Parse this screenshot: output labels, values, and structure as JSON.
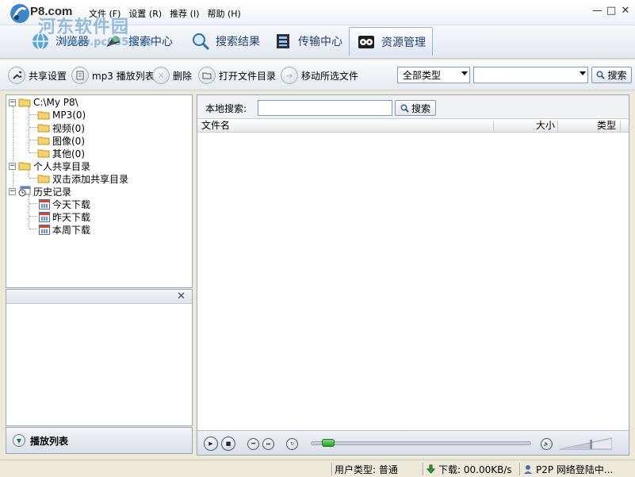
{
  "app": {
    "brand": "P8.com",
    "watermark_line1": "河东软件园",
    "watermark_line2": "www.pc0359.cn"
  },
  "menu": [
    "文件 (F)",
    "设置 (R)",
    "推荐 (I)",
    "帮助 (H)"
  ],
  "window_controls": {
    "minimize": "—",
    "maximize": "□",
    "close": "✕"
  },
  "tabs": [
    {
      "label": "浏览器",
      "icon": "browser-icon",
      "active": false
    },
    {
      "label": "搜索中心",
      "icon": "search-center-icon",
      "active": false
    },
    {
      "label": "搜索结果",
      "icon": "magnifier-icon",
      "active": false
    },
    {
      "label": "传输中心",
      "icon": "transfer-icon",
      "active": false
    },
    {
      "label": "资源管理",
      "icon": "film-reel-icon",
      "active": true
    }
  ],
  "toolbar": {
    "share_settings": "共享设置",
    "mp3_playlist": "mp3 播放列表",
    "delete": "删除",
    "open_folder": "打开文件目录",
    "move_selected": "移动所选文件",
    "type_filter": "全部类型",
    "search_value": "",
    "search_button": "搜索"
  },
  "tree": {
    "root": "C:\\My P8\\",
    "root_children": [
      "MP3(0)",
      "视频(0)",
      "图像(0)",
      "其他(0)"
    ],
    "shared": "个人共享目录",
    "shared_child": "双击添加共享目录",
    "history": "历史记录",
    "history_children": [
      "今天下载",
      "昨天下载",
      "本周下载"
    ]
  },
  "sub_panel": {
    "close": "✕"
  },
  "playlist": {
    "label": "播放列表"
  },
  "local_search": {
    "label": "本地搜索:",
    "value": "",
    "button": "搜索"
  },
  "file_table": {
    "columns": [
      "文件名",
      "大小",
      "类型"
    ],
    "rows": []
  },
  "player": {
    "seek_fraction": 0.04,
    "volume_fraction": 0.6
  },
  "status": {
    "user_type": "用户类型: 普通",
    "download": "下载: 00.00KB/s",
    "network": "P2P 网络登陆中..."
  }
}
